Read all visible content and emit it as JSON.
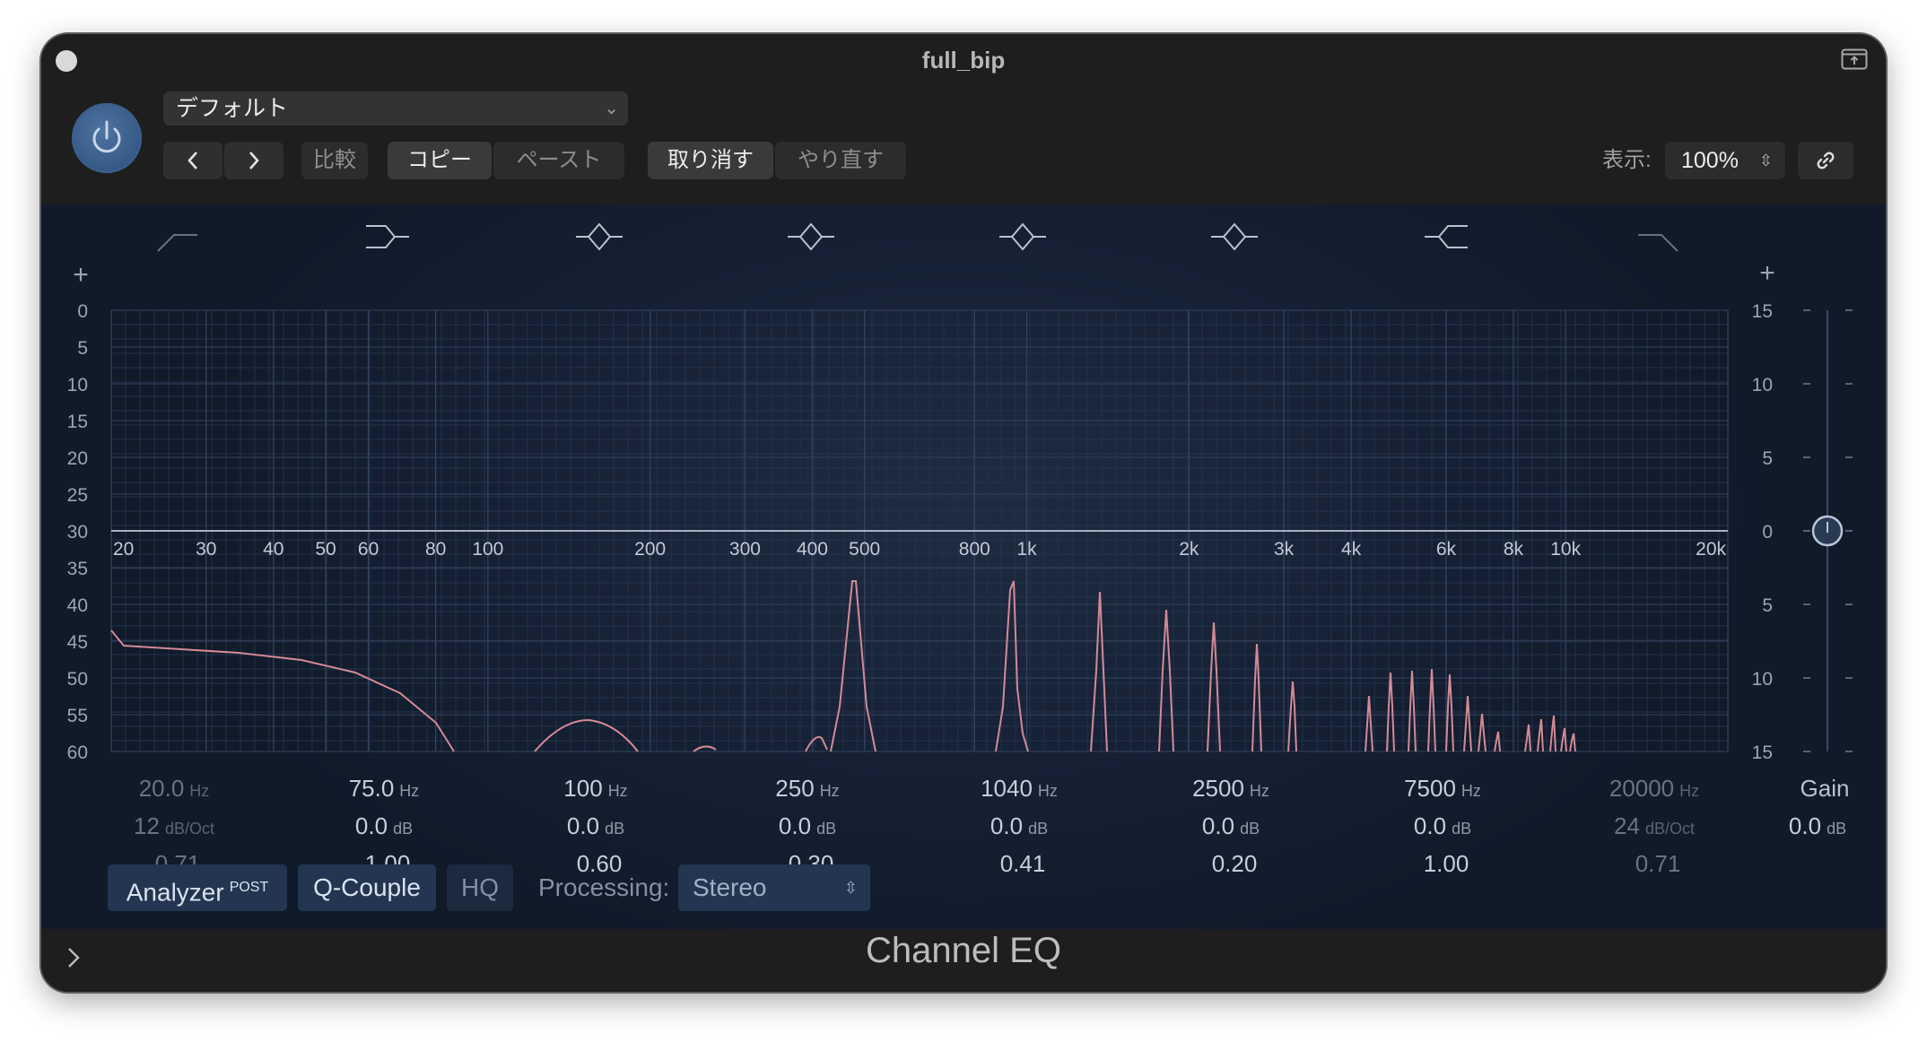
{
  "window": {
    "title": "full_bip"
  },
  "header": {
    "preset": "デフォルト",
    "compare_label": "比較",
    "copy_label": "コピー",
    "paste_label": "ペースト",
    "undo_label": "取り消す",
    "redo_label": "やり直す",
    "view_label": "表示:",
    "zoom_value": "100%"
  },
  "eq": {
    "analyzer_scale": [
      "0",
      "5",
      "10",
      "15",
      "20",
      "25",
      "30",
      "35",
      "40",
      "45",
      "50",
      "55",
      "60"
    ],
    "gain_scale": [
      "15",
      "10",
      "5",
      "0",
      "5",
      "10",
      "15"
    ],
    "freq_labels": [
      {
        "label": "20",
        "hz": 20
      },
      {
        "label": "30",
        "hz": 30
      },
      {
        "label": "40",
        "hz": 40
      },
      {
        "label": "50",
        "hz": 50
      },
      {
        "label": "60",
        "hz": 60
      },
      {
        "label": "80",
        "hz": 80
      },
      {
        "label": "100",
        "hz": 100
      },
      {
        "label": "200",
        "hz": 200
      },
      {
        "label": "300",
        "hz": 300
      },
      {
        "label": "400",
        "hz": 400
      },
      {
        "label": "500",
        "hz": 500
      },
      {
        "label": "800",
        "hz": 800
      },
      {
        "label": "1k",
        "hz": 1000
      },
      {
        "label": "2k",
        "hz": 2000
      },
      {
        "label": "3k",
        "hz": 3000
      },
      {
        "label": "4k",
        "hz": 4000
      },
      {
        "label": "6k",
        "hz": 6000
      },
      {
        "label": "8k",
        "hz": 8000
      },
      {
        "label": "10k",
        "hz": 10000
      },
      {
        "label": "20k",
        "hz": 20000
      }
    ],
    "plus_label": "+",
    "bands": [
      {
        "type": "low-cut",
        "icon": "low-cut-icon",
        "freq": "20.0",
        "freq_unit": "Hz",
        "gain": "12",
        "gain_unit": "dB/Oct",
        "q": "0.71",
        "active": false
      },
      {
        "type": "low-shelf",
        "icon": "low-shelf-icon",
        "freq": "75.0",
        "freq_unit": "Hz",
        "gain": "0.0",
        "gain_unit": "dB",
        "q": "1.00",
        "active": true
      },
      {
        "type": "bell",
        "icon": "bell-icon",
        "freq": "100",
        "freq_unit": "Hz",
        "gain": "0.0",
        "gain_unit": "dB",
        "q": "0.60",
        "active": true
      },
      {
        "type": "bell",
        "icon": "bell-icon",
        "freq": "250",
        "freq_unit": "Hz",
        "gain": "0.0",
        "gain_unit": "dB",
        "q": "0.30",
        "active": true
      },
      {
        "type": "bell",
        "icon": "bell-icon",
        "freq": "1040",
        "freq_unit": "Hz",
        "gain": "0.0",
        "gain_unit": "dB",
        "q": "0.41",
        "active": true
      },
      {
        "type": "bell",
        "icon": "bell-icon",
        "freq": "2500",
        "freq_unit": "Hz",
        "gain": "0.0",
        "gain_unit": "dB",
        "q": "0.20",
        "active": true
      },
      {
        "type": "high-shelf",
        "icon": "high-shelf-icon",
        "freq": "7500",
        "freq_unit": "Hz",
        "gain": "0.0",
        "gain_unit": "dB",
        "q": "1.00",
        "active": true
      },
      {
        "type": "high-cut",
        "icon": "high-cut-icon",
        "freq": "20000",
        "freq_unit": "Hz",
        "gain": "24",
        "gain_unit": "dB/Oct",
        "q": "0.71",
        "active": false
      }
    ],
    "master_gain": {
      "label": "Gain",
      "value": "0.0",
      "unit": "dB"
    },
    "analyzer_label": "Analyzer",
    "analyzer_post": "POST",
    "qcouple_label": "Q-Couple",
    "hq_label": "HQ",
    "processing_label": "Processing:",
    "processing_value": "Stereo"
  },
  "footer": {
    "title": "Channel EQ"
  },
  "colors": {
    "accent": "#4a70a0",
    "analyzer_curve": "#d48a96",
    "panel": "#1e1e1e"
  }
}
